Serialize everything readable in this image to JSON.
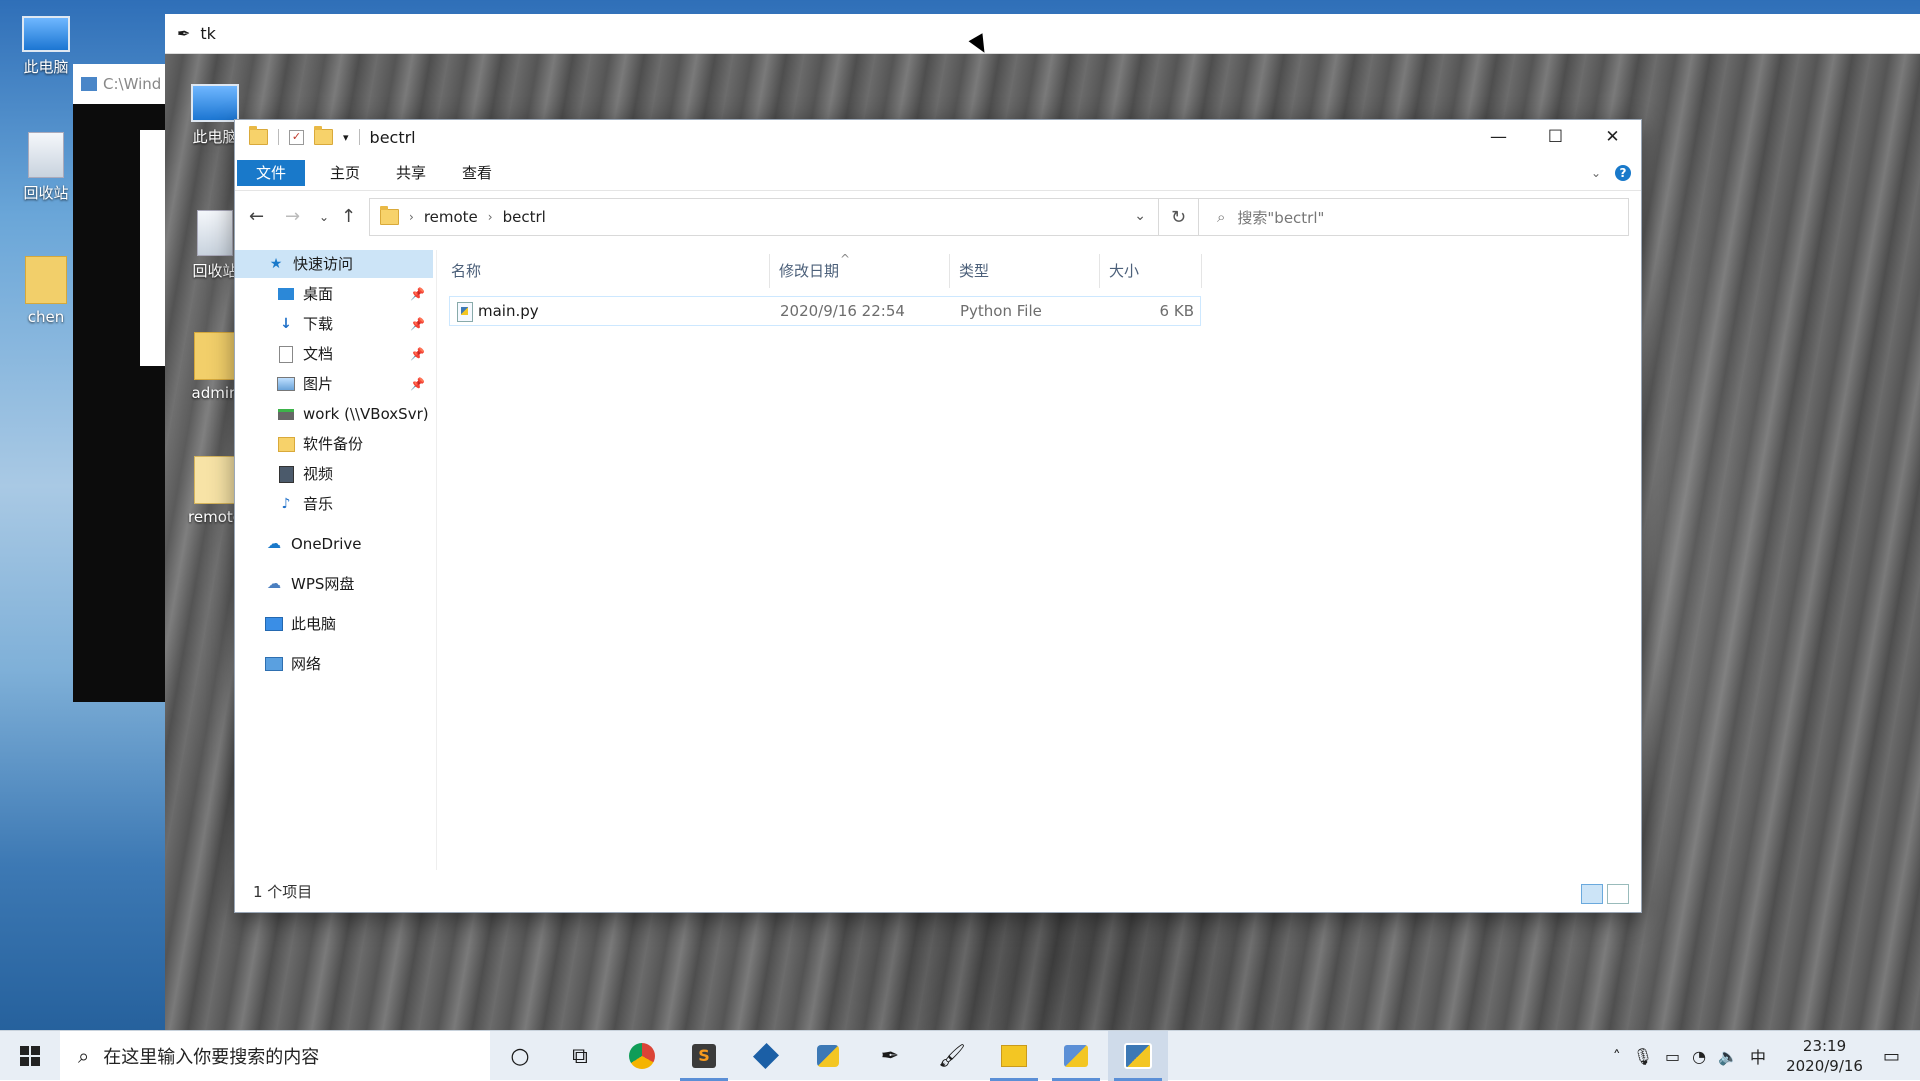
{
  "desktop": {
    "icons": [
      {
        "label": "此电脑",
        "icon": "computer-icon"
      },
      {
        "label": "回收站",
        "icon": "recycle-bin-icon"
      },
      {
        "label": "chen",
        "icon": "user-folder-icon"
      }
    ]
  },
  "console": {
    "title": "C:\\Wind"
  },
  "tk_window": {
    "title": "tk",
    "desktop_icons": [
      {
        "label": "此电脑",
        "icon": "computer-icon"
      },
      {
        "label": "回收站",
        "icon": "recycle-bin-icon"
      },
      {
        "label": "admin",
        "icon": "user-folder-icon"
      },
      {
        "label": "remote",
        "icon": "folder-icon"
      }
    ]
  },
  "explorer": {
    "title": "bectrl",
    "ribbon_tabs": [
      "文件",
      "主页",
      "共享",
      "查看"
    ],
    "address": {
      "crumbs": [
        "remote",
        "bectrl"
      ]
    },
    "search": {
      "placeholder": "搜索\"bectrl\""
    },
    "nav": {
      "quick_access": "快速访问",
      "pinned": [
        {
          "label": "桌面",
          "icon": "desktop-icon"
        },
        {
          "label": "下载",
          "icon": "download-icon"
        },
        {
          "label": "文档",
          "icon": "document-icon"
        },
        {
          "label": "图片",
          "icon": "picture-icon"
        }
      ],
      "others": [
        {
          "label": "work (\\\\VBoxSvr)",
          "icon": "network-drive-icon"
        },
        {
          "label": "软件备份",
          "icon": "folder-icon"
        },
        {
          "label": "视频",
          "icon": "video-icon"
        },
        {
          "label": "音乐",
          "icon": "music-icon"
        }
      ],
      "roots": [
        {
          "label": "OneDrive",
          "icon": "cloud-icon"
        },
        {
          "label": "WPS网盘",
          "icon": "cloud-outline-icon"
        },
        {
          "label": "此电脑",
          "icon": "computer-icon"
        },
        {
          "label": "网络",
          "icon": "network-icon"
        }
      ]
    },
    "columns": {
      "name": "名称",
      "modified": "修改日期",
      "type": "类型",
      "size": "大小"
    },
    "files": [
      {
        "name": "main.py",
        "modified": "2020/9/16 22:54",
        "type": "Python File",
        "size": "6 KB"
      }
    ],
    "status": "1 个项目"
  },
  "taskbar": {
    "search_placeholder": "在这里输入你要搜索的内容",
    "apps": [
      "cortana-icon",
      "task-view-icon",
      "chrome-icon",
      "sublime-icon",
      "virtualbox-icon",
      "python-icon",
      "feather-icon",
      "paint-icon",
      "file-explorer-icon",
      "python-launcher-icon",
      "python-tk-icon"
    ],
    "ime": "中",
    "time": "23:19",
    "date": "2020/9/16"
  },
  "colors": {
    "accent": "#1979ca",
    "selection": "#cce4f7"
  }
}
